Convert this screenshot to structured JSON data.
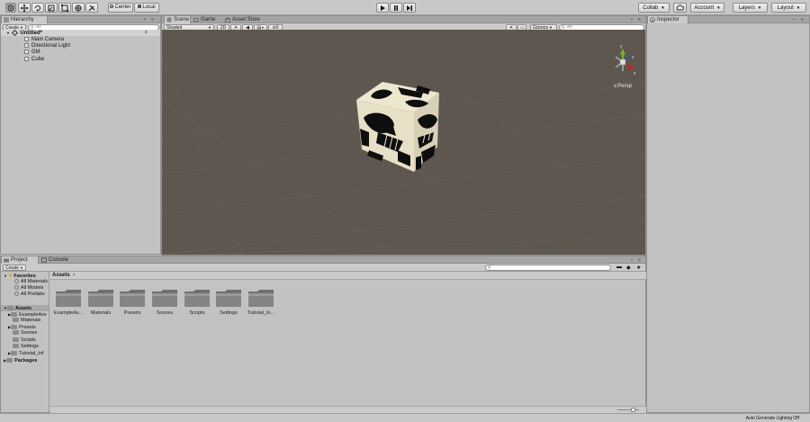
{
  "toolbar": {
    "pivot": "Center",
    "space": "Local",
    "collab": "Collab",
    "account": "Account",
    "layers": "Layers",
    "layout": "Layout"
  },
  "hierarchy": {
    "tab": "Hierarchy",
    "create": "Create",
    "search_placeholder": "All",
    "scene": "Untitled*",
    "items": [
      "Main Camera",
      "Directional Light",
      "GM",
      "Cube"
    ]
  },
  "scene": {
    "tabs": [
      "Scene",
      "Game",
      "Asset Store"
    ],
    "shading": "Shaded",
    "mode2d": "2D",
    "fx_count": "0",
    "gizmos": "Gizmos",
    "search_placeholder": "All",
    "persp": "Persp",
    "gizmo_axes": {
      "y": "y",
      "x": "x",
      "z": "z"
    }
  },
  "inspector": {
    "tab": "Inspector"
  },
  "project": {
    "tabs": [
      "Project",
      "Console"
    ],
    "create": "Create",
    "favorites_label": "Favorites",
    "favorites": [
      "All Materials",
      "All Models",
      "All Prefabs"
    ],
    "assets_root": "Assets",
    "asset_folders_tree": [
      "ExampleAss",
      "Materials",
      "Presets",
      "Scenes",
      "Scripts",
      "Settings",
      "Tutorial_Inf"
    ],
    "packages_label": "Packages",
    "breadcrumb": "Assets",
    "grid_items": [
      "ExampleAs...",
      "Materials",
      "Presets",
      "Scenes",
      "Scripts",
      "Settings",
      "Tutorial_In..."
    ]
  },
  "status": {
    "text": "Auto Generate Lighting Off"
  },
  "colors": {
    "scene_bg": "#5e574f",
    "panel_bg": "#c2c2c2",
    "cube_light": "#ede6cf",
    "cube_dark": "#0d0d0d"
  }
}
